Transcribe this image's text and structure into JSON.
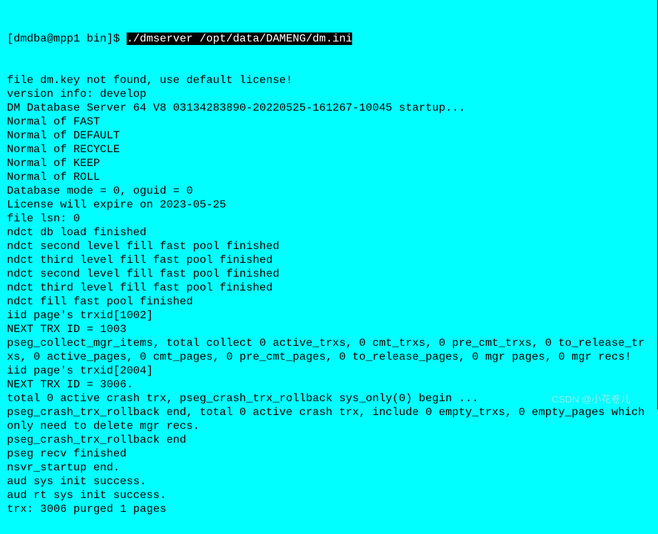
{
  "prompt": "[dmdba@mpp1 bin]$ ",
  "command": "./dmserver /opt/data/DAMENG/dm.ini",
  "lines": [
    "file dm.key not found, use default license!",
    "version info: develop",
    "DM Database Server 64 V8 03134283890-20220525-161267-10045 startup...",
    "Normal of FAST",
    "Normal of DEFAULT",
    "Normal of RECYCLE",
    "Normal of KEEP",
    "Normal of ROLL",
    "Database mode = 0, oguid = 0",
    "License will expire on 2023-05-25",
    "file lsn: 0",
    "ndct db load finished",
    "ndct second level fill fast pool finished",
    "ndct third level fill fast pool finished",
    "ndct second level fill fast pool finished",
    "ndct third level fill fast pool finished",
    "ndct fill fast pool finished",
    "iid page's trxid[1002]",
    "NEXT TRX ID = 1003",
    "pseg_collect_mgr_items, total collect 0 active_trxs, 0 cmt_trxs, 0 pre_cmt_trxs, 0 to_release_trxs, 0 active_pages, 0 cmt_pages, 0 pre_cmt_pages, 0 to_release_pages, 0 mgr pages, 0 mgr recs!",
    "iid page's trxid[2004]",
    "NEXT TRX ID = 3006.",
    "total 0 active crash trx, pseg_crash_trx_rollback sys_only(0) begin ...",
    "pseg_crash_trx_rollback end, total 0 active crash trx, include 0 empty_trxs, 0 empty_pages which only need to delete mgr recs.",
    "pseg_crash_trx_rollback end",
    "pseg recv finished",
    "nsvr_startup end.",
    "aud sys init success.",
    "aud rt sys init success.",
    "trx: 3006 purged 1 pages"
  ],
  "watermark": "CSDN @小花卷儿  "
}
